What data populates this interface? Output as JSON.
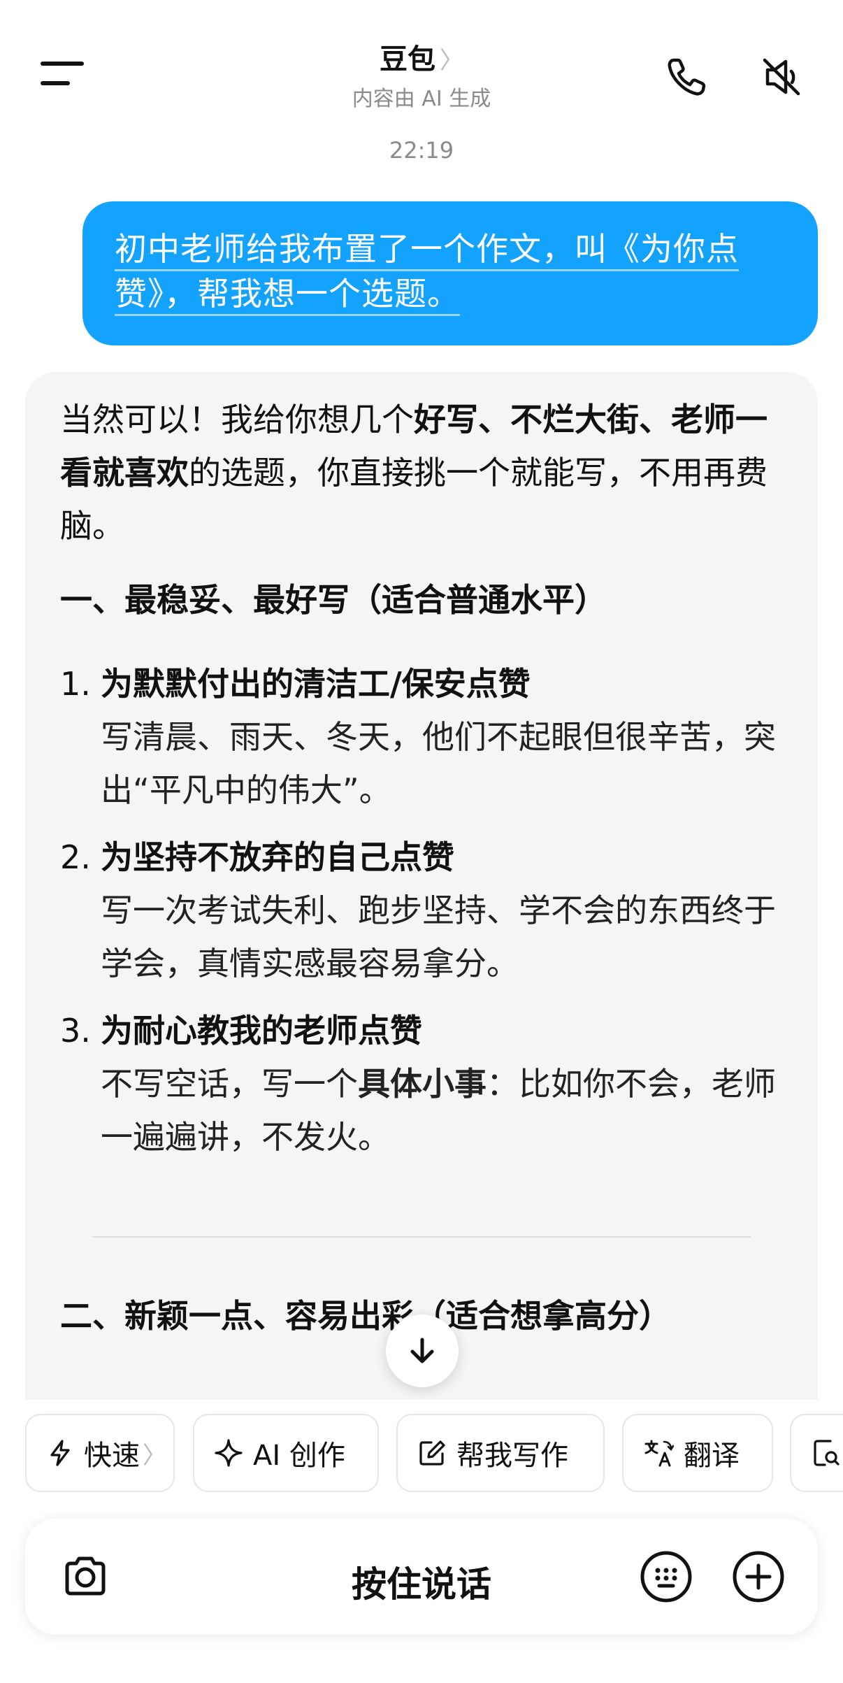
{
  "header": {
    "title": "豆包",
    "title_chevron": "〉",
    "subtitle": "内容由 AI 生成",
    "icons": [
      "menu-icon",
      "phone-icon",
      "speaker-mute-icon"
    ]
  },
  "timestamp": "22:19",
  "user_message": "初中老师给我布置了一个作文，叫《为你点赞》，帮我想一个选题。",
  "ai_message": {
    "intro_plain_1": "当然可以！我给你想几个",
    "intro_bold": "好写、不烂大街、老师一看就喜欢",
    "intro_plain_2": "的选题，你直接挑一个就能写，不用再费脑。",
    "section1_heading": "一、最稳妥、最好写（适合普通水平）",
    "items": [
      {
        "num": "1.",
        "title": "为默默付出的清洁工/保安点赞",
        "desc": "写清晨、雨天、冬天，他们不起眼但很辛苦，突出“平凡中的伟大”。"
      },
      {
        "num": "2.",
        "title": "为坚持不放弃的自己点赞",
        "desc": "写一次考试失利、跑步坚持、学不会的东西终于学会，真情实感最容易拿分。"
      },
      {
        "num": "3.",
        "title": "为耐心教我的老师点赞",
        "desc_1": "不写空话，写一个",
        "desc_bold": "具体小事",
        "desc_2": "：比如你不会，老师一遍遍讲，不发火。"
      }
    ],
    "section2_heading": "二、新颖一点、容易出彩（适合想拿高分）"
  },
  "chips": [
    {
      "label": "快速",
      "chevron": "〉",
      "icon": "lightning-icon"
    },
    {
      "label": "AI 创作",
      "icon": "sparkle-icon"
    },
    {
      "label": "帮我写作",
      "icon": "edit-icon"
    },
    {
      "label": "翻译",
      "icon": "translate-icon"
    },
    {
      "label": "",
      "icon": "document-search-icon"
    }
  ],
  "input_bar": {
    "hold_to_talk": "按住说话",
    "icons": [
      "camera-icon",
      "keyboard-icon",
      "plus-icon"
    ]
  },
  "colors": {
    "user_bubble": "#14a2ff",
    "ai_card": "#f5f5f5",
    "secondary_text": "#8a8a8a"
  }
}
